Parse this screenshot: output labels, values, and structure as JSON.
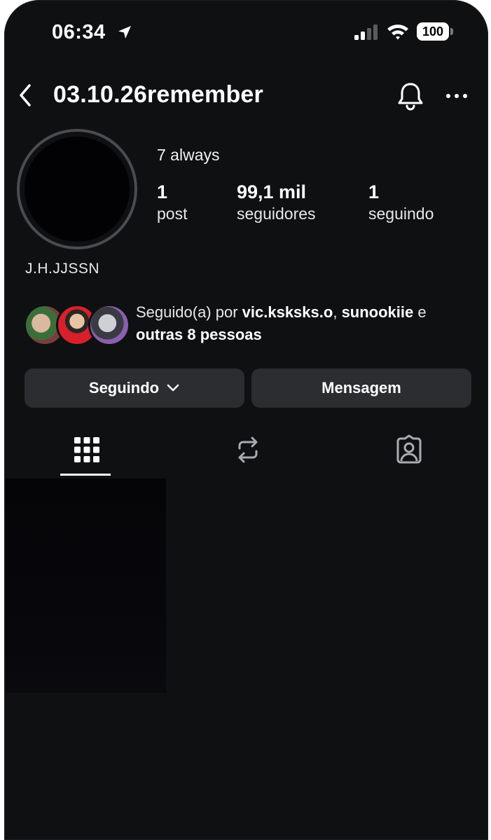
{
  "status_bar": {
    "time": "06:34",
    "battery": "100",
    "icons": [
      "location-arrow-icon",
      "cellular-signal-icon",
      "wifi-icon",
      "battery-icon"
    ]
  },
  "header": {
    "username": "03.10.26remember",
    "icons": [
      "chevron-left-icon",
      "bell-icon",
      "more-horizontal-icon"
    ]
  },
  "profile": {
    "display_name": "7 always",
    "bio_name": "J.H.JJSSN",
    "stats": [
      {
        "value": "1",
        "label": "post"
      },
      {
        "value": "99,1 mil",
        "label": "seguidores"
      },
      {
        "value": "1",
        "label": "seguindo"
      }
    ]
  },
  "followed_by": {
    "prefix": "Seguido(a) por ",
    "user1": "vic.ksksks.o",
    "separator": ", ",
    "user2": "sunookiie",
    "conjunction": " e ",
    "others": "outras 8 pessoas"
  },
  "actions": {
    "following_label": "Seguindo",
    "message_label": "Mensagem"
  },
  "tabs": [
    {
      "icon": "grid-icon",
      "active": true
    },
    {
      "icon": "repost-icon",
      "active": false
    },
    {
      "icon": "tagged-person-icon",
      "active": false
    }
  ],
  "colors": {
    "background": "#0f1012",
    "button": "#2c2d31",
    "text": "#ffffff",
    "avatar_ring": "#4a4c52"
  }
}
